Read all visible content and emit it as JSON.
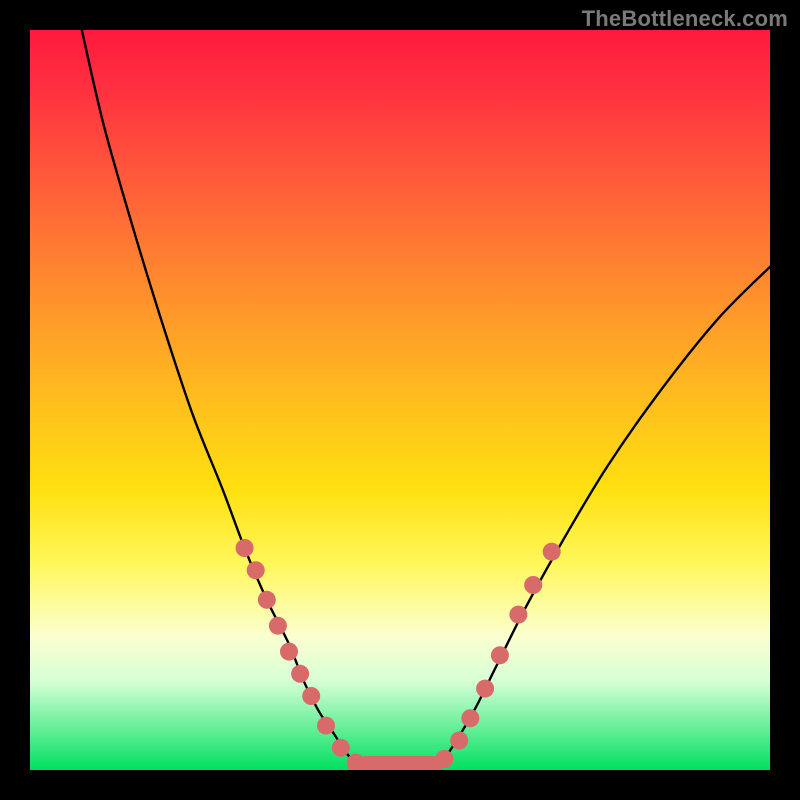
{
  "watermark": "TheBottleneck.com",
  "colors": {
    "dot": "#d86a6a",
    "curve": "#000000",
    "frame": "#000000",
    "gradient_top": "#ff1a3c",
    "gradient_bottom": "#00e060"
  },
  "chart_data": {
    "type": "line",
    "title": "",
    "xlabel": "",
    "ylabel": "",
    "xlim": [
      0,
      100
    ],
    "ylim": [
      0,
      100
    ],
    "grid": false,
    "legend": false,
    "series": [
      {
        "name": "left-branch",
        "x": [
          7,
          10,
          14,
          18,
          22,
          26,
          29,
          32,
          35,
          37,
          39,
          41,
          43,
          45
        ],
        "y": [
          100,
          87,
          73,
          60,
          48,
          38,
          30,
          23,
          17,
          12,
          8,
          5,
          2,
          0
        ]
      },
      {
        "name": "right-branch",
        "x": [
          55,
          57,
          60,
          63,
          67,
          72,
          78,
          85,
          93,
          100
        ],
        "y": [
          0,
          3,
          8,
          14,
          22,
          31,
          41,
          51,
          61,
          68
        ]
      }
    ],
    "flat_segment": {
      "x_start": 45,
      "x_end": 55,
      "y": 0
    },
    "markers_left": [
      {
        "x": 29,
        "y": 30
      },
      {
        "x": 30.5,
        "y": 27
      },
      {
        "x": 32,
        "y": 23
      },
      {
        "x": 33.5,
        "y": 19.5
      },
      {
        "x": 35,
        "y": 16
      },
      {
        "x": 36.5,
        "y": 13
      },
      {
        "x": 38,
        "y": 10
      },
      {
        "x": 40,
        "y": 6
      },
      {
        "x": 42,
        "y": 3
      },
      {
        "x": 44,
        "y": 1
      }
    ],
    "markers_right": [
      {
        "x": 56,
        "y": 1.5
      },
      {
        "x": 58,
        "y": 4
      },
      {
        "x": 59.5,
        "y": 7
      },
      {
        "x": 61.5,
        "y": 11
      },
      {
        "x": 63.5,
        "y": 15.5
      },
      {
        "x": 66,
        "y": 21
      },
      {
        "x": 68,
        "y": 25
      },
      {
        "x": 70.5,
        "y": 29.5
      }
    ],
    "markers_bottom": [
      {
        "x": 46,
        "y": 0
      },
      {
        "x": 48,
        "y": 0
      },
      {
        "x": 50,
        "y": 0
      },
      {
        "x": 52,
        "y": 0
      },
      {
        "x": 54,
        "y": 0
      }
    ]
  }
}
